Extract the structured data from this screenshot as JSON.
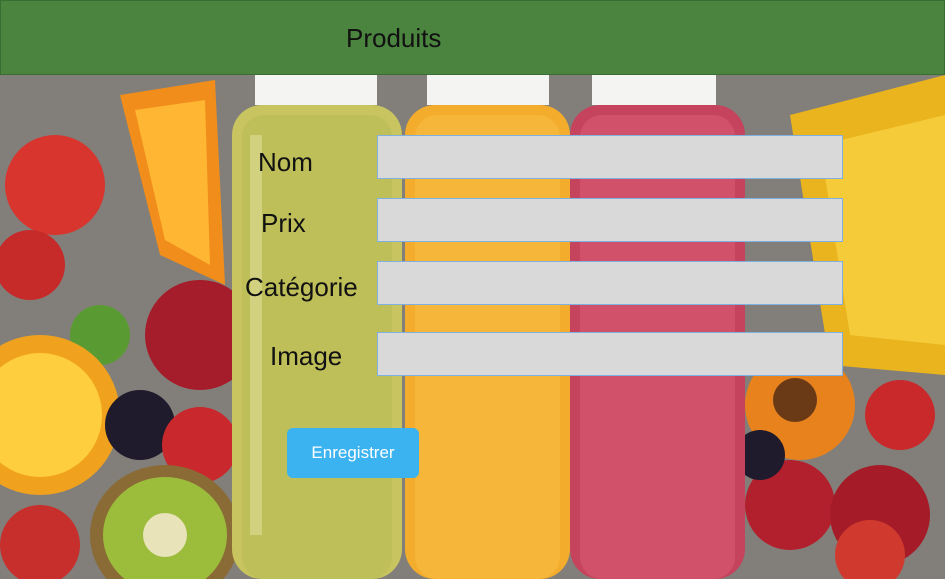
{
  "header": {
    "title": "Produits"
  },
  "form": {
    "fields": [
      {
        "label": "Nom",
        "value": "",
        "placeholder": ""
      },
      {
        "label": "Prix",
        "value": "",
        "placeholder": ""
      },
      {
        "label": "Catégorie",
        "value": "",
        "placeholder": ""
      },
      {
        "label": "Image",
        "value": "",
        "placeholder": ""
      }
    ],
    "submit_label": "Enregistrer"
  },
  "colors": {
    "header_bg": "#4a843e",
    "input_bg": "#d9d9d9",
    "input_border": "#7fb0e0",
    "button_bg": "#3bb3f0"
  }
}
